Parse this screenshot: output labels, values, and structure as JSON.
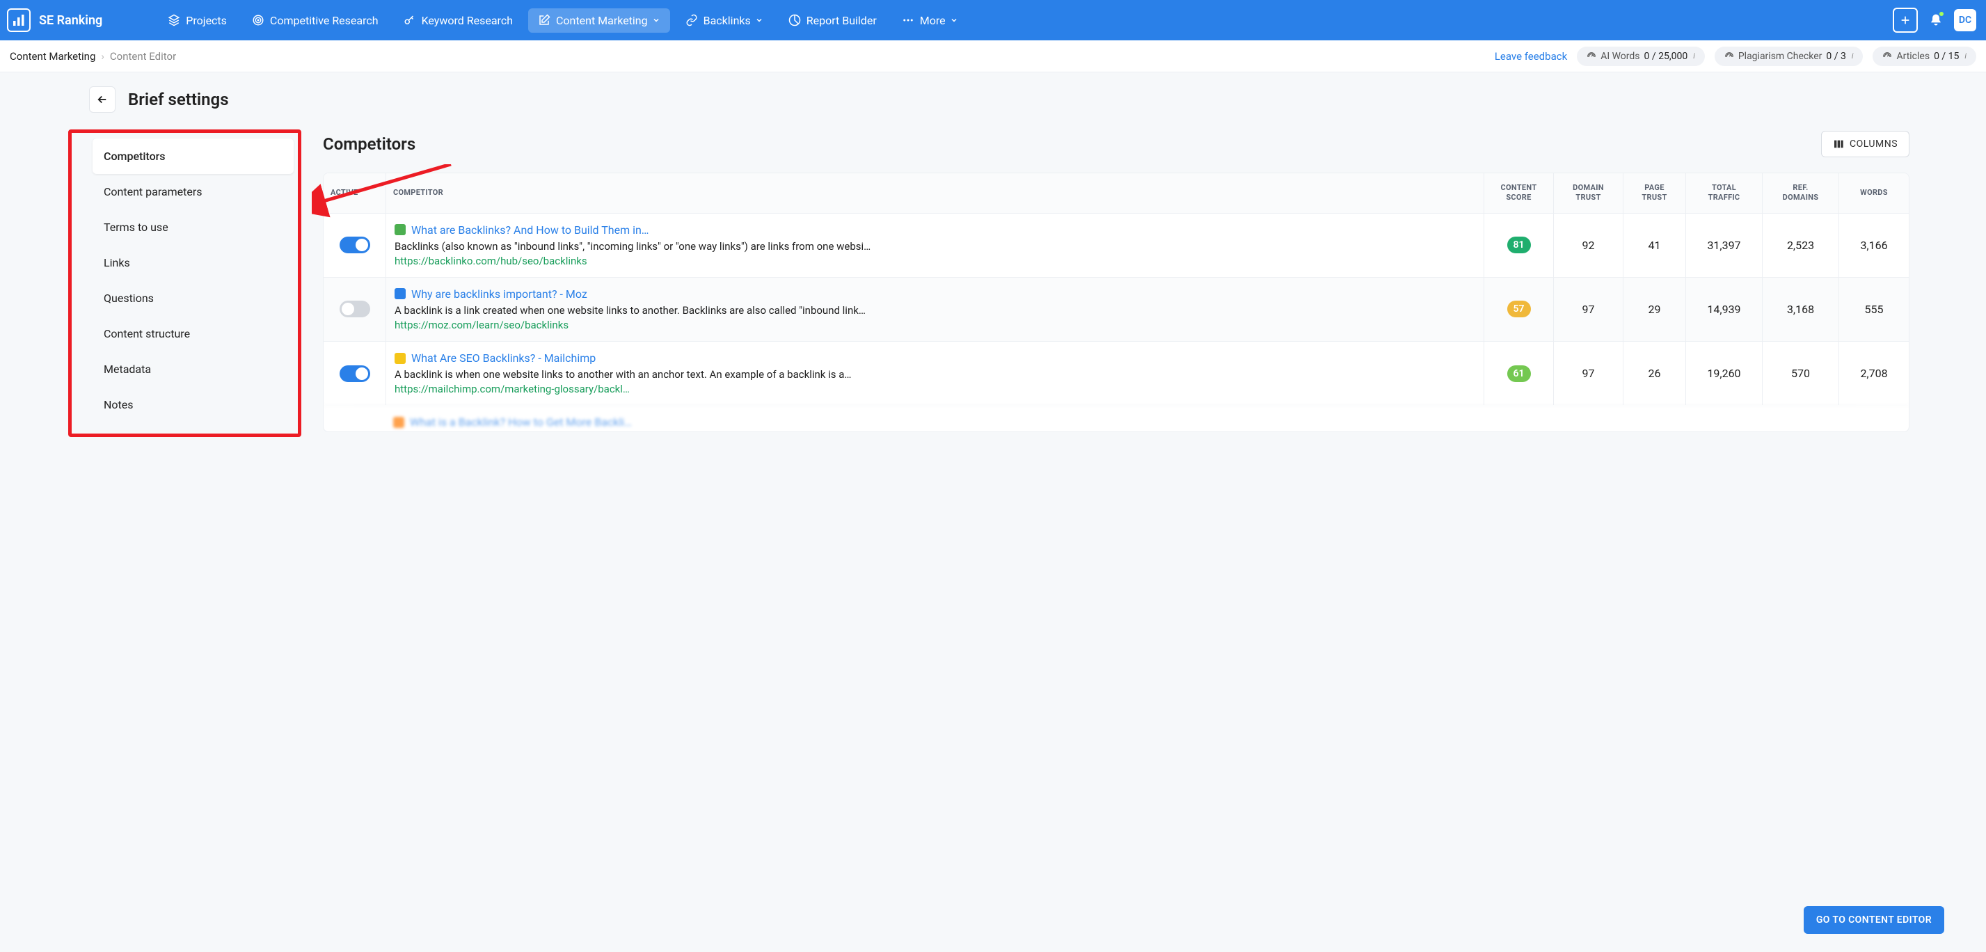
{
  "brand": "SE Ranking",
  "nav": {
    "projects": "Projects",
    "comp_research": "Competitive Research",
    "keyword_research": "Keyword Research",
    "content_mkt": "Content Marketing",
    "backlinks": "Backlinks",
    "report_builder": "Report Builder",
    "more": "More"
  },
  "avatar": "DC",
  "crumbs": {
    "a": "Content Marketing",
    "b": "Content Editor"
  },
  "feedback_label": "Leave feedback",
  "pills": {
    "ai_words": {
      "label": "AI Words",
      "value": "0 / 25,000"
    },
    "plag": {
      "label": "Plagiarism Checker",
      "value": "0 / 3"
    },
    "articles": {
      "label": "Articles",
      "value": "0 / 15"
    }
  },
  "page_title": "Brief settings",
  "side_tabs": [
    "Competitors",
    "Content parameters",
    "Terms to use",
    "Links",
    "Questions",
    "Content structure",
    "Metadata",
    "Notes"
  ],
  "panel": {
    "title": "Competitors",
    "columns_btn": "COLUMNS"
  },
  "headers": {
    "active": "ACTIVE",
    "competitor": "COMPETITOR",
    "content_score_1": "CONTENT",
    "content_score_2": "SCORE",
    "domain_trust_1": "DOMAIN",
    "domain_trust_2": "TRUST",
    "page_trust_1": "PAGE",
    "page_trust_2": "TRUST",
    "total_traffic_1": "TOTAL",
    "total_traffic_2": "TRAFFIC",
    "ref_domains_1": "REF.",
    "ref_domains_2": "DOMAINS",
    "words": "WORDS"
  },
  "rows": [
    {
      "active": true,
      "fav_color": "#4caf50",
      "title": "What are Backlinks? And How to Build Them in…",
      "desc": "Backlinks (also known as \"inbound links\", \"incoming links\" or \"one way links\") are links from one websi…",
      "url": "https://backlinko.com/hub/seo/backlinks",
      "score": "81",
      "score_cls": "green",
      "domain_trust": "92",
      "page_trust": "41",
      "traffic": "31,397",
      "ref_domains": "2,523",
      "words": "3,166"
    },
    {
      "active": false,
      "fav_color": "#2a80e8",
      "title": "Why are backlinks important? - Moz",
      "desc": "A backlink is a link created when one website links to another. Backlinks are also called \"inbound link…",
      "url": "https://moz.com/learn/seo/backlinks",
      "score": "57",
      "score_cls": "yellow",
      "domain_trust": "97",
      "page_trust": "29",
      "traffic": "14,939",
      "ref_domains": "3,168",
      "words": "555"
    },
    {
      "active": true,
      "fav_color": "#f5c518",
      "title": "What Are SEO Backlinks? - Mailchimp",
      "desc": "A backlink is when one website links to another with an anchor text. An example of a backlink is a…",
      "url": "https://mailchimp.com/marketing-glossary/backl…",
      "score": "61",
      "score_cls": "lime",
      "domain_trust": "97",
      "page_trust": "26",
      "traffic": "19,260",
      "ref_domains": "570",
      "words": "2,708"
    }
  ],
  "partial_row": {
    "fav_color": "#ff7a00",
    "title": "What is a Backlink? How to Get More Backlink…"
  },
  "cta": "GO TO CONTENT EDITOR"
}
